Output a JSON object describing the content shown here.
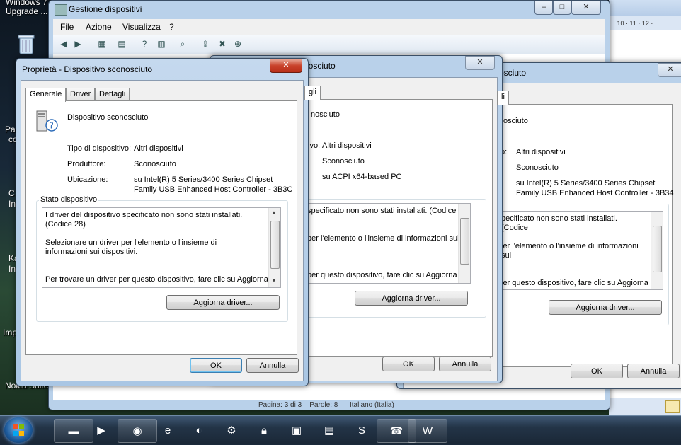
{
  "desktop": {
    "labels": [
      "Windows 7",
      "Upgrade ...",
      "Pa",
      "co",
      "C",
      "In",
      "Ka",
      "In",
      "Imp",
      "Nokia Suite"
    ]
  },
  "devmgr": {
    "title": "Gestione dispositivi",
    "menu": [
      "File",
      "Azione",
      "Visualizza",
      "?"
    ],
    "status": {
      "page": "Pagina: 3 di 3",
      "words": "Parole: 8",
      "lang": "Italiano (Italia)"
    },
    "ruler": "· 10 · 11 · 12 ·"
  },
  "dialog_front": {
    "title": "Proprietà - Dispositivo sconosciuto",
    "tabs": [
      "Generale",
      "Driver",
      "Dettagli"
    ],
    "device_name": "Dispositivo sconosciuto",
    "type_label": "Tipo di dispositivo:",
    "type_value": "Altri dispositivi",
    "mfr_label": "Produttore:",
    "mfr_value": "Sconosciuto",
    "loc_label": "Ubicazione:",
    "loc_value_1": "su Intel(R) 5 Series/3400 Series Chipset",
    "loc_value_2": "Family USB Enhanced Host Controller - 3B3C",
    "status_group": "Stato dispositivo",
    "status_p1": "I driver del dispositivo specificato non sono stati installati. (Codice 28)",
    "status_p2": "Selezionare un driver per l'elemento o l'insieme di informazioni sui dispositivi.",
    "status_p3": "Per trovare un driver per questo dispositivo, fare clic su Aggiorna",
    "update_button": "Aggiorna driver...",
    "ok": "OK",
    "cancel": "Annulla"
  },
  "dialog_middle": {
    "title": "nosciuto",
    "tab_partial": "gli",
    "device_name": "nosciuto",
    "type_label": "ivo:",
    "type_value": "Altri dispositivi",
    "mfr_value": "Sconosciuto",
    "loc_value_1": "su ACPI x64-based PC",
    "status_p1": "specificato non sono stati installati. (Codice",
    "status_p2": "per l'elemento o l'insieme di informazioni sui",
    "status_p3": "per questo dispositivo, fare clic su Aggiorna",
    "update_button": "Aggiorna driver...",
    "ok": "OK",
    "cancel": "Annulla"
  },
  "dialog_back": {
    "title": "osciuto",
    "device_name": "osciuto",
    "type_label": "o:",
    "type_value": "Altri dispositivi",
    "mfr_value": "Sconosciuto",
    "loc_value_1": "su Intel(R) 5 Series/3400 Series Chipset",
    "loc_value_2": "Family USB Enhanced Host Controller - 3B34",
    "status_p1": "pecificato non sono stati installati. (Codice",
    "status_p2": "ler l'elemento o l'insieme di informazioni sui",
    "status_p3": "ler questo dispositivo, fare clic su Aggiorna",
    "update_button": "Aggiorna driver...",
    "ok": "OK",
    "cancel": "Annulla"
  },
  "taskbar": {
    "icons": [
      "explorer-icon",
      "media-player-icon",
      "chrome-icon",
      "ie-icon",
      "firefox-icon",
      "steam-icon",
      "vpn-icon",
      "network-icon",
      "hardware-icon",
      "skype-icon",
      "fax-icon",
      "word-icon"
    ]
  }
}
